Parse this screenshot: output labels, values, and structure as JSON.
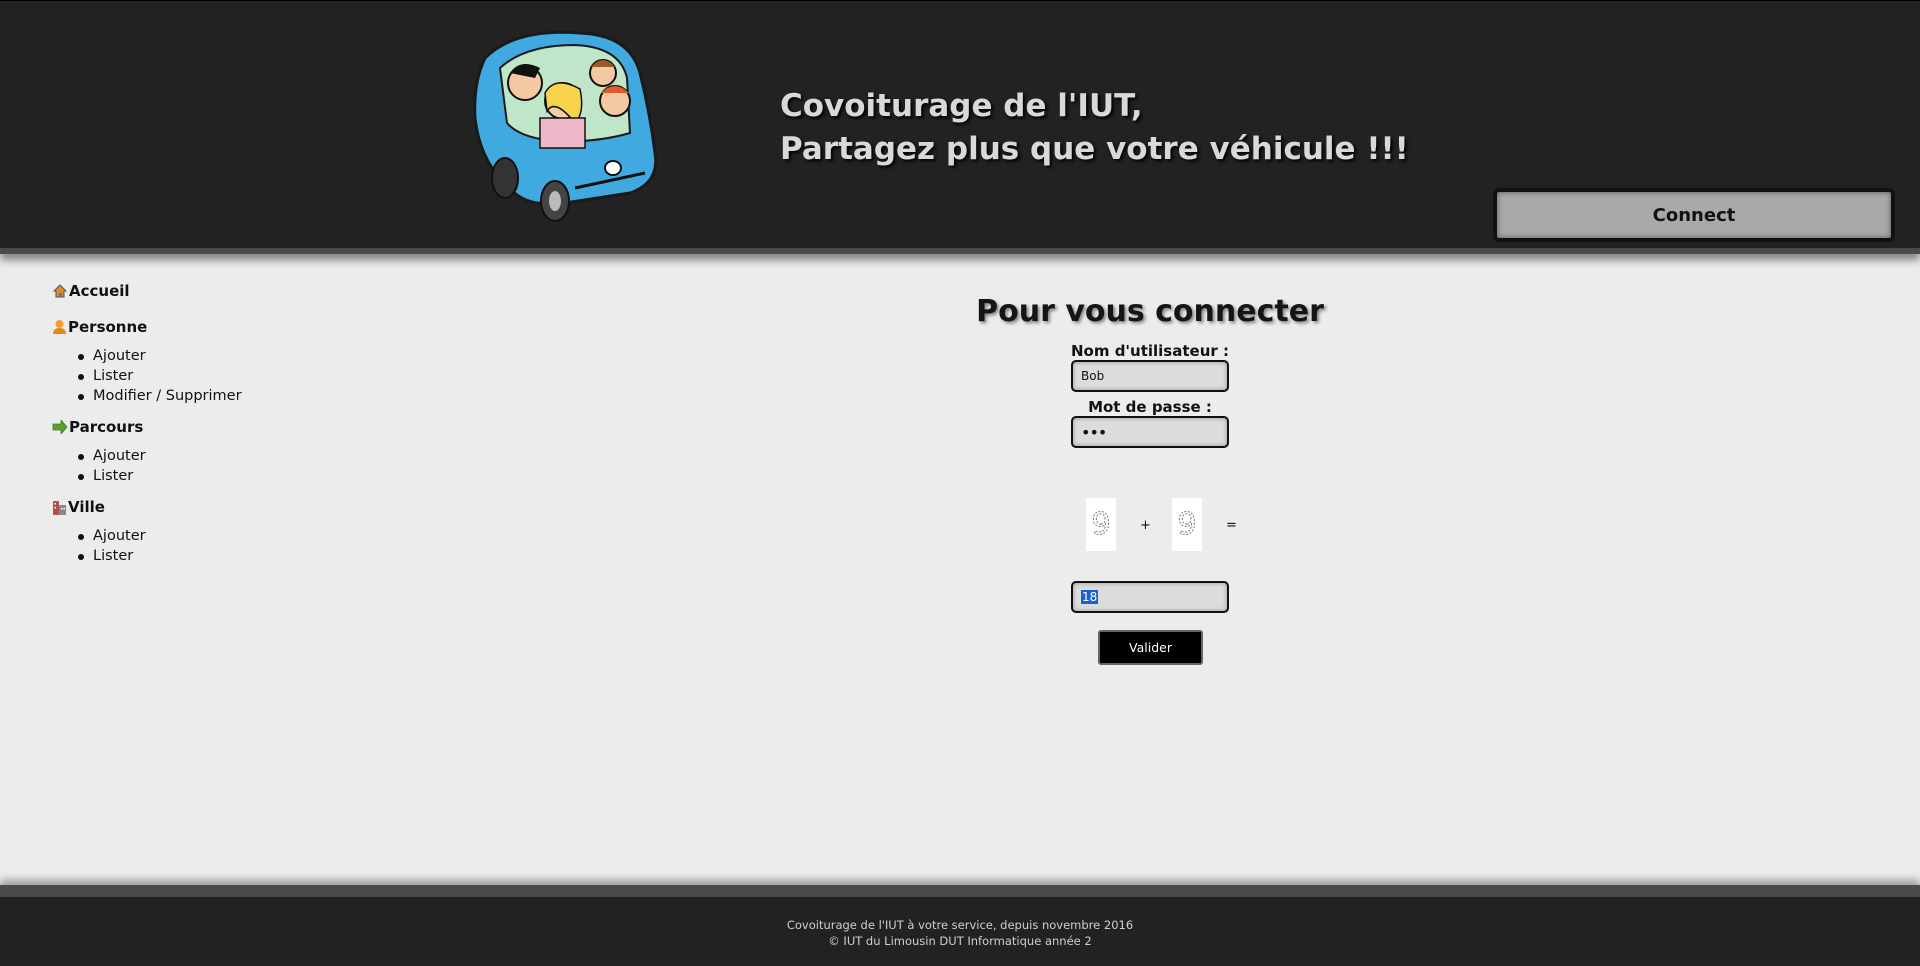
{
  "header": {
    "tagline_line1": "Covoiturage de l'IUT,",
    "tagline_line2": "Partagez plus que votre véhicule !!!",
    "connect_label": "Connect",
    "logo_icon": "carpool-car-illustration"
  },
  "sidebar": {
    "sections": [
      {
        "label": "Accueil",
        "icon": "home-icon",
        "items": []
      },
      {
        "label": "Personne",
        "icon": "person-icon",
        "items": [
          "Ajouter",
          "Lister",
          "Modifier / Supprimer"
        ]
      },
      {
        "label": "Parcours",
        "icon": "arrow-right-icon",
        "items": [
          "Ajouter",
          "Lister"
        ]
      },
      {
        "label": "Ville",
        "icon": "building-icon",
        "items": [
          "Ajouter",
          "Lister"
        ]
      }
    ]
  },
  "login": {
    "title": "Pour vous connecter",
    "username_label": "Nom d'utilisateur :",
    "username_value": "Bob",
    "password_label": "Mot de passe :",
    "password_value": "•••",
    "captcha": {
      "digit1": "9",
      "operator": "+",
      "digit2": "9",
      "equals": "="
    },
    "captcha_answer": "18",
    "submit_label": "Valider"
  },
  "footer": {
    "line1": "Covoiturage de l'IUT à votre service, depuis novembre 2016",
    "line2": "© IUT du Limousin DUT Informatique année 2"
  },
  "colors": {
    "header_bg": "#222222",
    "page_bg": "#ececec",
    "connect_bg": "#a9a9a9",
    "selection": "#1a62d4"
  }
}
